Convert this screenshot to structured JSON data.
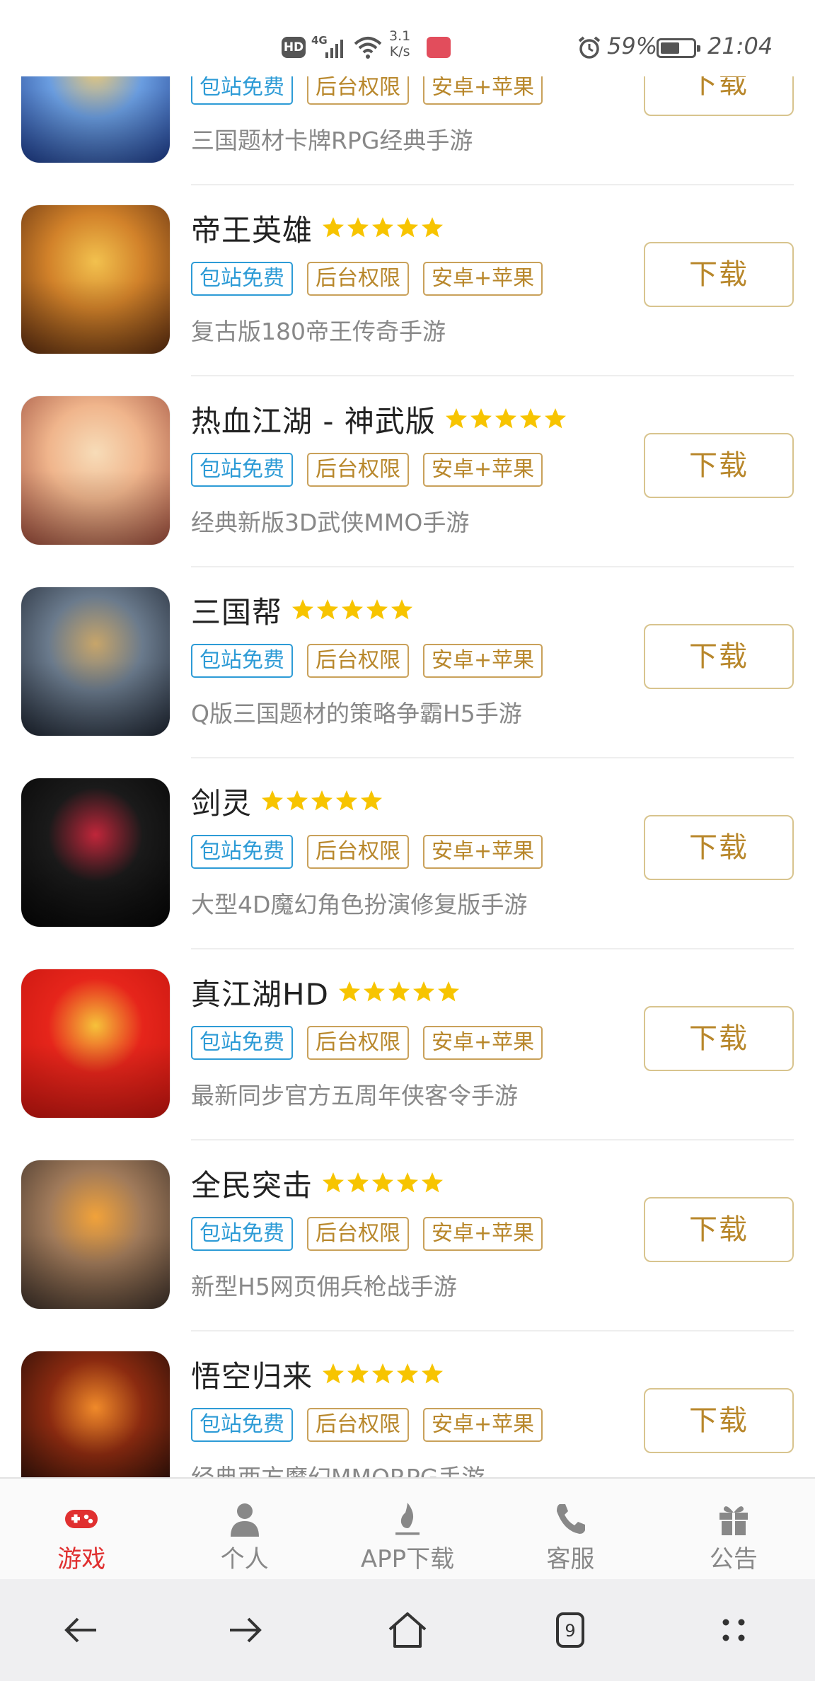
{
  "status_bar": {
    "hd": "HD",
    "network": "4G",
    "speed_value": "3.1",
    "speed_unit": "K/s",
    "battery_percent": "59%",
    "battery_level": 0.59,
    "time": "21:04"
  },
  "tags": {
    "free": "包站免费",
    "admin": "后台权限",
    "platform": "安卓+苹果"
  },
  "download_label": "下载",
  "rating_stars": 5,
  "games": [
    {
      "name": "",
      "desc": "三国题材卡牌RPG经典手游",
      "icon": "blue-armored-hero-icon",
      "colors": [
        "#1c3a8a",
        "#6a9de0",
        "#e8c87a"
      ]
    },
    {
      "name": "帝王英雄",
      "desc": "复古版180帝王传奇手游",
      "icon": "emperor-hero-icon",
      "colors": [
        "#5a2b0f",
        "#d2822a",
        "#f2c14e"
      ]
    },
    {
      "name": "热血江湖 - 神武版",
      "desc": "经典新版3D武侠MMO手游",
      "icon": "anime-girl-icon",
      "colors": [
        "#9a4a3a",
        "#f0b58c",
        "#f7dcb8"
      ]
    },
    {
      "name": "三国帮",
      "desc": "Q版三国题材的策略争霸H5手游",
      "icon": "warrior-portrait-icon",
      "colors": [
        "#1d2430",
        "#6a7a8c",
        "#c7a56a"
      ]
    },
    {
      "name": "剑灵",
      "desc": "大型4D魔幻角色扮演修复版手游",
      "icon": "blade-soul-logo-icon",
      "colors": [
        "#050505",
        "#1a1a1a",
        "#c0263a"
      ]
    },
    {
      "name": "真江湖HD",
      "desc": "最新同步官方五周年侠客令手游",
      "icon": "zhen-jianghu-logo-icon",
      "colors": [
        "#c4150f",
        "#e6251b",
        "#f6c23a"
      ]
    },
    {
      "name": "全民突击",
      "desc": "新型H5网页佣兵枪战手游",
      "icon": "soldier-sunglasses-icon",
      "colors": [
        "#3b2f28",
        "#a07a5a",
        "#f1a23a"
      ]
    },
    {
      "name": "悟空归来",
      "desc": "经典西方魔幻MMORPG手游",
      "icon": "wukong-fire-icon",
      "colors": [
        "#1a0a06",
        "#8a2a10",
        "#f08a2a"
      ]
    }
  ],
  "tabbar": [
    {
      "label": "游戏",
      "icon": "gamepad-icon",
      "active": true
    },
    {
      "label": "个人",
      "icon": "person-icon",
      "active": false
    },
    {
      "label": "APP下载",
      "icon": "flame-download-icon",
      "active": false
    },
    {
      "label": "客服",
      "icon": "phone-icon",
      "active": false
    },
    {
      "label": "公告",
      "icon": "gift-icon",
      "active": false
    }
  ],
  "navbar": {
    "tab_count": "9",
    "buttons": [
      "back-arrow-icon",
      "forward-arrow-icon",
      "home-icon",
      "tabs-icon",
      "menu-dots-icon"
    ]
  },
  "colors": {
    "active_tab": "#e03030",
    "inactive_tab": "#888888",
    "tag_blue": "#2d9bd6",
    "tag_gold": "#b8872b",
    "star": "#f7c400",
    "download_border": "#d8c48e"
  }
}
